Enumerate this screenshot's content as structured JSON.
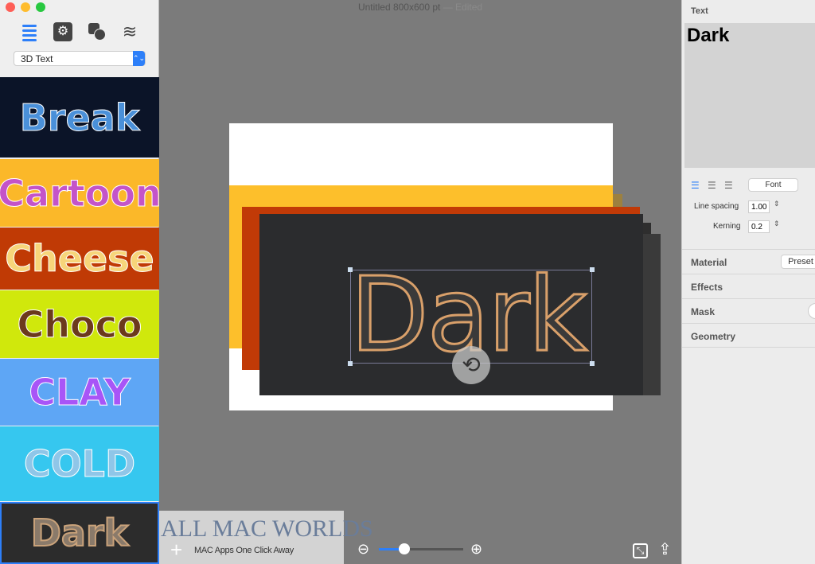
{
  "window": {
    "title": "Untitled 800x600 pt",
    "edited": "— Edited"
  },
  "sidebar": {
    "preset_category": "3D Text",
    "tools": [
      "list-icon",
      "gear-icon",
      "shapes-icon",
      "layers-icon"
    ],
    "presets": [
      {
        "label": "Break",
        "bg": "#0b1428",
        "fg": "#4a90d9"
      },
      {
        "label": "Cartoon",
        "bg": "#fbb829",
        "fg": "#c454c8"
      },
      {
        "label": "Cheese",
        "bg": "#c03a05",
        "fg": "#f7d57a"
      },
      {
        "label": "Choco",
        "bg": "#d0e80c",
        "fg": "#6b3a1c"
      },
      {
        "label": "CLAY",
        "bg": "#5ea6f5",
        "fg": "#a855f7"
      },
      {
        "label": "COLD",
        "bg": "#36c7ef",
        "fg": "#8fc6e8"
      },
      {
        "label": "Dark",
        "bg": "#2c2c2c",
        "fg": "#8a7a6a"
      }
    ]
  },
  "canvas": {
    "text": "Dark",
    "zoom_level": 0.3
  },
  "watermark": {
    "title": "ALL MAC WORLDS",
    "tagline": "MAC Apps One Click Away"
  },
  "inspector": {
    "text_label": "Text",
    "text_value": "Dark",
    "font_button": "Font",
    "line_spacing_label": "Line spacing",
    "line_spacing": "1.00",
    "kerning_label": "Kerning",
    "kerning": "0.2",
    "sections": {
      "material": "Material",
      "preset": "Preset",
      "effects": "Effects",
      "mask": "Mask",
      "geometry": "Geometry"
    }
  }
}
